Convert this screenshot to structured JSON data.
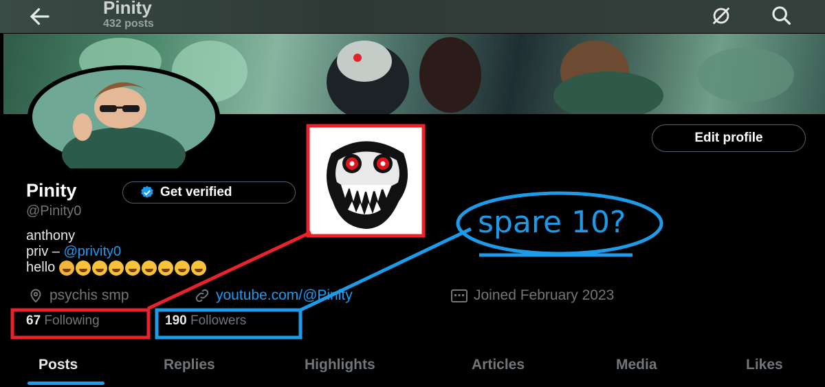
{
  "header": {
    "name": "Pinity",
    "post_count": "432 posts"
  },
  "profile": {
    "display_name": "Pinity",
    "verify_label": "Get verified",
    "handle": "@Pinity0",
    "edit_label": "Edit profile",
    "bio_line1": "anthony",
    "bio_line2_prefix": "priv – ",
    "bio_line2_link": "@privity0",
    "bio_line3": "hello",
    "location": "psychis smp",
    "website": "youtube.com/@Pinity",
    "joined": "Joined February 2023",
    "following_count": "67",
    "following_label": "Following",
    "followers_count": "190",
    "followers_label": "Followers"
  },
  "tabs": [
    {
      "label": "Posts"
    },
    {
      "label": "Replies"
    },
    {
      "label": "Highlights"
    },
    {
      "label": "Articles"
    },
    {
      "label": "Media"
    },
    {
      "label": "Likes"
    }
  ],
  "annotation": {
    "caption": "spare 10?",
    "red": "#e8232b",
    "blue": "#1d9be8"
  },
  "colors": {
    "accent": "#1d9bf0",
    "muted": "#71767b"
  }
}
